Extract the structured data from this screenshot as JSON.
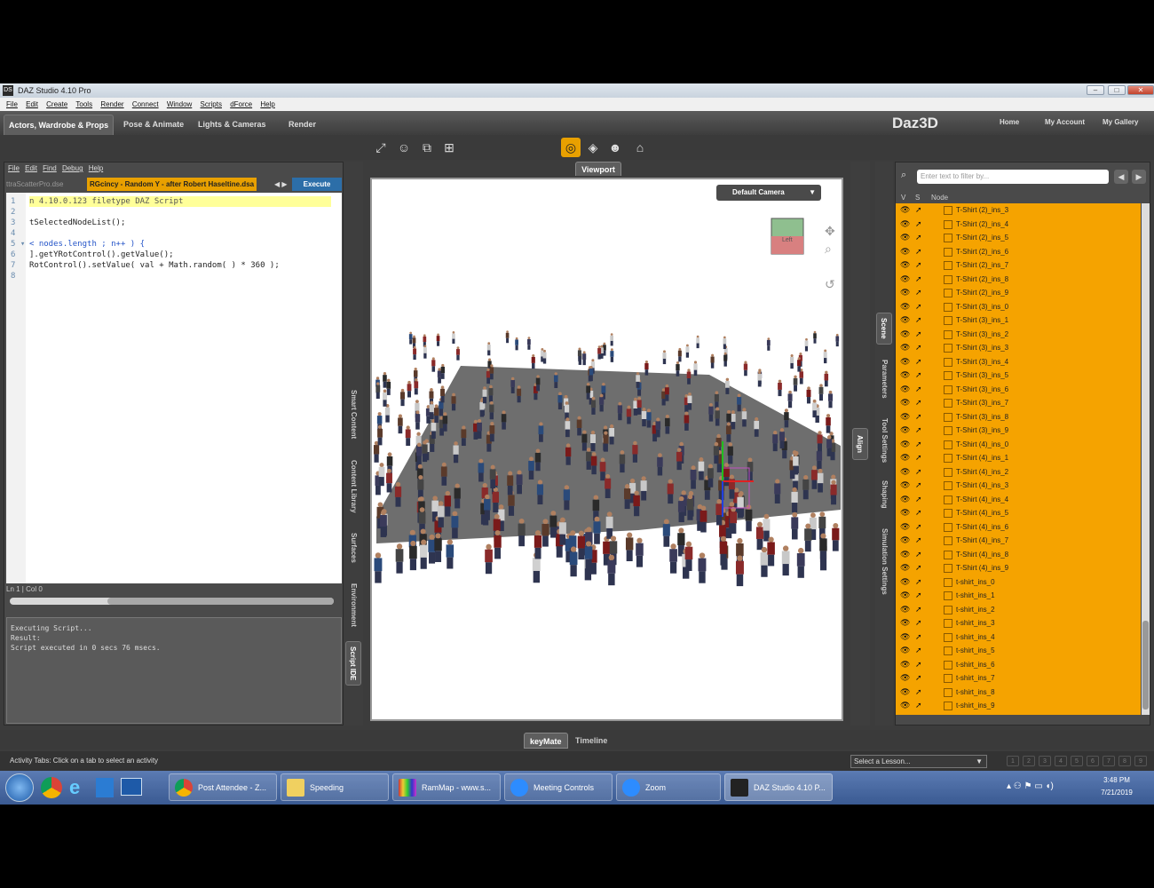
{
  "window": {
    "title": "DAZ Studio 4.10 Pro",
    "logo": "DS"
  },
  "menu": [
    "File",
    "Edit",
    "Create",
    "Tools",
    "Render",
    "Connect",
    "Window",
    "Scripts",
    "dForce",
    "Help"
  ],
  "activity_tabs": [
    "Actors, Wardrobe & Props",
    "Pose & Animate",
    "Lights & Cameras",
    "Render"
  ],
  "brand": "Daz3D",
  "top_links": [
    "Home",
    "My Account",
    "My Gallery"
  ],
  "script_ide": {
    "menu": [
      "File",
      "Edit",
      "Find",
      "Debug",
      "Help"
    ],
    "file_tab_1": "ttraScatterPro.dse",
    "file_tab_2": "RGcincy - Random Y - after Robert Haseltine.dsa",
    "nav": "◀ ▶",
    "execute_label": "Execute",
    "code": [
      {
        "n": "1",
        "t": "n 4.10.0.123 filetype DAZ Script"
      },
      {
        "n": "2",
        "t": ""
      },
      {
        "n": "3",
        "t": "tSelectedNodeList();"
      },
      {
        "n": "4",
        "t": ""
      },
      {
        "n": "5 ▾",
        "t": "< nodes.length ; n++ ) {"
      },
      {
        "n": "6",
        "t": "].getYRotControl().getValue();"
      },
      {
        "n": "7",
        "t": "RotControl().setValue( val + Math.random( ) * 360 );"
      },
      {
        "n": "8",
        "t": ""
      }
    ],
    "status": "Ln   1  |  Col   0",
    "output": [
      "Executing Script...",
      "Result:",
      "Script executed in 0 secs 76 msecs."
    ]
  },
  "left_side_tabs": [
    "Smart Content",
    "Content Library",
    "Surfaces",
    "Environment",
    "Script IDE"
  ],
  "viewport": {
    "tab": "Viewport",
    "camera": "Default Camera",
    "cube_face": "Left"
  },
  "align_tab": "Align",
  "right_side_tabs": [
    "Scene",
    "Parameters",
    "Tool Settings",
    "Shaping",
    "Simulation Settings"
  ],
  "scene": {
    "filter_placeholder": "Enter text to filter by...",
    "headers": [
      "V",
      "S",
      "Node"
    ],
    "nodes": [
      "T-Shirt (2)_ins_3",
      "T-Shirt (2)_ins_4",
      "T-Shirt (2)_ins_5",
      "T-Shirt (2)_ins_6",
      "T-Shirt (2)_ins_7",
      "T-Shirt (2)_ins_8",
      "T-Shirt (2)_ins_9",
      "T-Shirt (3)_ins_0",
      "T-Shirt (3)_ins_1",
      "T-Shirt (3)_ins_2",
      "T-Shirt (3)_ins_3",
      "T-Shirt (3)_ins_4",
      "T-Shirt (3)_ins_5",
      "T-Shirt (3)_ins_6",
      "T-Shirt (3)_ins_7",
      "T-Shirt (3)_ins_8",
      "T-Shirt (3)_ins_9",
      "T-Shirt (4)_ins_0",
      "T-Shirt (4)_ins_1",
      "T-Shirt (4)_ins_2",
      "T-Shirt (4)_ins_3",
      "T-Shirt (4)_ins_4",
      "T-Shirt (4)_ins_5",
      "T-Shirt (4)_ins_6",
      "T-Shirt (4)_ins_7",
      "T-Shirt (4)_ins_8",
      "T-Shirt (4)_ins_9",
      "t-shirt_ins_0",
      "t-shirt_ins_1",
      "t-shirt_ins_2",
      "t-shirt_ins_3",
      "t-shirt_ins_4",
      "t-shirt_ins_5",
      "t-shirt_ins_6",
      "t-shirt_ins_7",
      "t-shirt_ins_8",
      "t-shirt_ins_9"
    ]
  },
  "bottom_tabs": [
    "keyMate",
    "Timeline"
  ],
  "status": {
    "text": "Activity Tabs: Click on a tab to select an activity",
    "lesson": "Select a Lesson...",
    "pages": [
      "1",
      "2",
      "3",
      "4",
      "5",
      "6",
      "7",
      "8",
      "9"
    ]
  },
  "taskbar": {
    "items": [
      "Post Attendee - Z...",
      "Speeding",
      "RamMap - www.s...",
      "Meeting Controls",
      "Zoom",
      "DAZ Studio 4.10 P..."
    ],
    "time": "3:48 PM",
    "date": "7/21/2019"
  },
  "colors": {
    "accent": "#f5a300",
    "execute": "#2c6ea8"
  }
}
